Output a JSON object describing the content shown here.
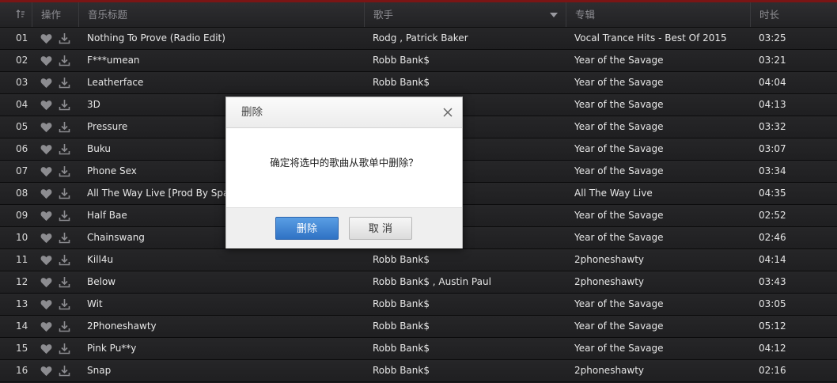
{
  "header": {
    "ops": "操作",
    "title": "音乐标题",
    "artist": "歌手",
    "album": "专辑",
    "duration": "时长"
  },
  "rows": [
    {
      "num": "01",
      "title": "Nothing To Prove (Radio Edit)",
      "artist": "Rodg , Patrick Baker",
      "album": "Vocal Trance Hits - Best Of 2015",
      "duration": "03:25"
    },
    {
      "num": "02",
      "title": "F***umean",
      "artist": "Robb Bank$",
      "album": "Year of the Savage",
      "duration": "03:21"
    },
    {
      "num": "03",
      "title": "Leatherface",
      "artist": "Robb Bank$",
      "album": "Year of the Savage",
      "duration": "04:04"
    },
    {
      "num": "04",
      "title": "3D",
      "artist": "",
      "album": "Year of the Savage",
      "duration": "04:13"
    },
    {
      "num": "05",
      "title": "Pressure",
      "artist": "",
      "album": "Year of the Savage",
      "duration": "03:32"
    },
    {
      "num": "06",
      "title": "Buku",
      "artist": "",
      "album": "Year of the Savage",
      "duration": "03:07"
    },
    {
      "num": "07",
      "title": "Phone Sex",
      "artist": "",
      "album": "Year of the Savage",
      "duration": "03:34"
    },
    {
      "num": "08",
      "title": "All The Way Live [Prod By Space",
      "artist": "",
      "album": "All The Way Live",
      "duration": "04:35"
    },
    {
      "num": "09",
      "title": "Half Bae",
      "artist": "",
      "album": "Year of the Savage",
      "duration": "02:52"
    },
    {
      "num": "10",
      "title": "Chainswang",
      "artist": "",
      "album": "Year of the Savage",
      "duration": "02:46"
    },
    {
      "num": "11",
      "title": "Kill4u",
      "artist": "Robb Bank$",
      "album": "2phoneshawty",
      "duration": "04:14"
    },
    {
      "num": "12",
      "title": "Below",
      "artist": "Robb Bank$ , Austin Paul",
      "album": "2phoneshawty",
      "duration": "03:43"
    },
    {
      "num": "13",
      "title": "Wit",
      "artist": "Robb Bank$",
      "album": "Year of the Savage",
      "duration": "03:05"
    },
    {
      "num": "14",
      "title": "2Phoneshawty",
      "artist": "Robb Bank$",
      "album": "Year of the Savage",
      "duration": "05:12"
    },
    {
      "num": "15",
      "title": "Pink Pu**y",
      "artist": "Robb Bank$",
      "album": "Year of the Savage",
      "duration": "04:12"
    },
    {
      "num": "16",
      "title": "Snap",
      "artist": "Robb Bank$",
      "album": "2phoneshawty",
      "duration": "02:16"
    }
  ],
  "dialog": {
    "title": "删除",
    "message": "确定将选中的歌曲从歌单中删除？",
    "confirm_label": "删除",
    "cancel_label": "取 消"
  },
  "icons": {
    "sort": "sort-icon",
    "heart": "heart-icon",
    "download": "download-icon",
    "dropdown": "chevron-down-icon",
    "close": "close-icon"
  },
  "colors": {
    "accent_bar": "#7a1515",
    "primary_button": "#2f72c4",
    "row_background": "#222224"
  }
}
